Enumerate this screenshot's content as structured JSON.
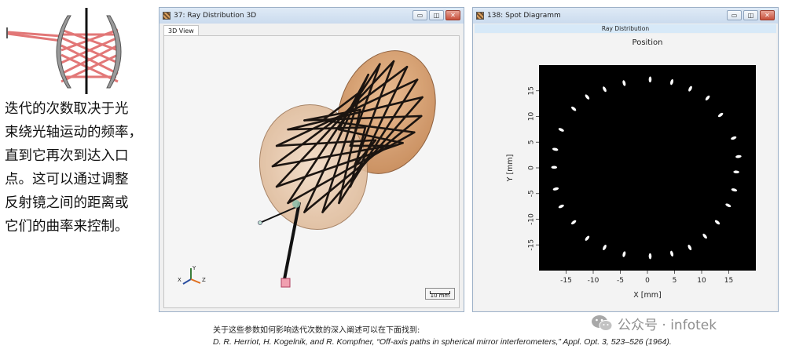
{
  "intro_text_lines": [
    "迭代的次数取决于光",
    "束绕光轴运动的频率，",
    "直到它再次到达入口",
    "点。这可以通过调整",
    "反射镜之间的距离或",
    "它们的曲率来控制。"
  ],
  "window_3d": {
    "title": "37: Ray Distribution 3D",
    "tab_label": "3D View",
    "scale_label": "10 mm",
    "axis_labels": {
      "x": "X",
      "y": "Y",
      "z": "Z"
    },
    "buttons": {
      "minimize": "▭",
      "restore": "◫",
      "close": "✕"
    }
  },
  "window_spot": {
    "title": "138: Spot Diagramm",
    "subtab_label": "Ray Distribution",
    "buttons": {
      "minimize": "▭",
      "restore": "◫",
      "close": "✕"
    }
  },
  "chart_data": {
    "type": "scatter",
    "title": "Position",
    "xlabel": "X [mm]",
    "ylabel": "Y [mm]",
    "xlim": [
      -20,
      20
    ],
    "ylim": [
      -20,
      20
    ],
    "x_ticks": [
      -15,
      -10,
      -5,
      0,
      5,
      10,
      15
    ],
    "y_ticks": [
      15,
      10,
      5,
      0,
      -5,
      -10,
      -15
    ],
    "background": "#000000",
    "marker_color": "#ffffff",
    "grid": false,
    "points": [
      {
        "x": 0.5,
        "y": 17.2
      },
      {
        "x": 4.5,
        "y": 16.7
      },
      {
        "x": 7.9,
        "y": 15.4
      },
      {
        "x": 11.1,
        "y": 13.6
      },
      {
        "x": 13.5,
        "y": 10.3
      },
      {
        "x": 15.9,
        "y": 5.8
      },
      {
        "x": 16.8,
        "y": 2.2
      },
      {
        "x": 16.4,
        "y": -0.8
      },
      {
        "x": 16.0,
        "y": -4.3
      },
      {
        "x": 14.9,
        "y": -7.3
      },
      {
        "x": 12.9,
        "y": -10.6
      },
      {
        "x": 10.6,
        "y": -13.3
      },
      {
        "x": 7.8,
        "y": -15.5
      },
      {
        "x": 4.5,
        "y": -16.7
      },
      {
        "x": 0.5,
        "y": -17.2
      },
      {
        "x": -4.3,
        "y": -16.8
      },
      {
        "x": -7.9,
        "y": -15.5
      },
      {
        "x": -11.1,
        "y": -13.7
      },
      {
        "x": -13.6,
        "y": -10.6
      },
      {
        "x": -15.9,
        "y": -7.5
      },
      {
        "x": -16.9,
        "y": -4.1
      },
      {
        "x": -17.2,
        "y": 0.1
      },
      {
        "x": -17.0,
        "y": 3.6
      },
      {
        "x": -15.9,
        "y": 7.4
      },
      {
        "x": -13.6,
        "y": 11.5
      },
      {
        "x": -11.1,
        "y": 13.8
      },
      {
        "x": -7.9,
        "y": 15.3
      },
      {
        "x": -4.3,
        "y": 16.5
      }
    ]
  },
  "footer": {
    "line1": "关于这些参数如何影响迭代次数的深入阐述可以在下面找到:",
    "line2": "D. R. Herriot, H. Kogelnik, and R. Kompfner, “Off-axis paths in spherical mirror interferometers,” Appl. Opt. 3, 523–526 (1964)."
  },
  "watermark": {
    "text": "公众号 · infotek",
    "icon": "wechat-icon"
  }
}
